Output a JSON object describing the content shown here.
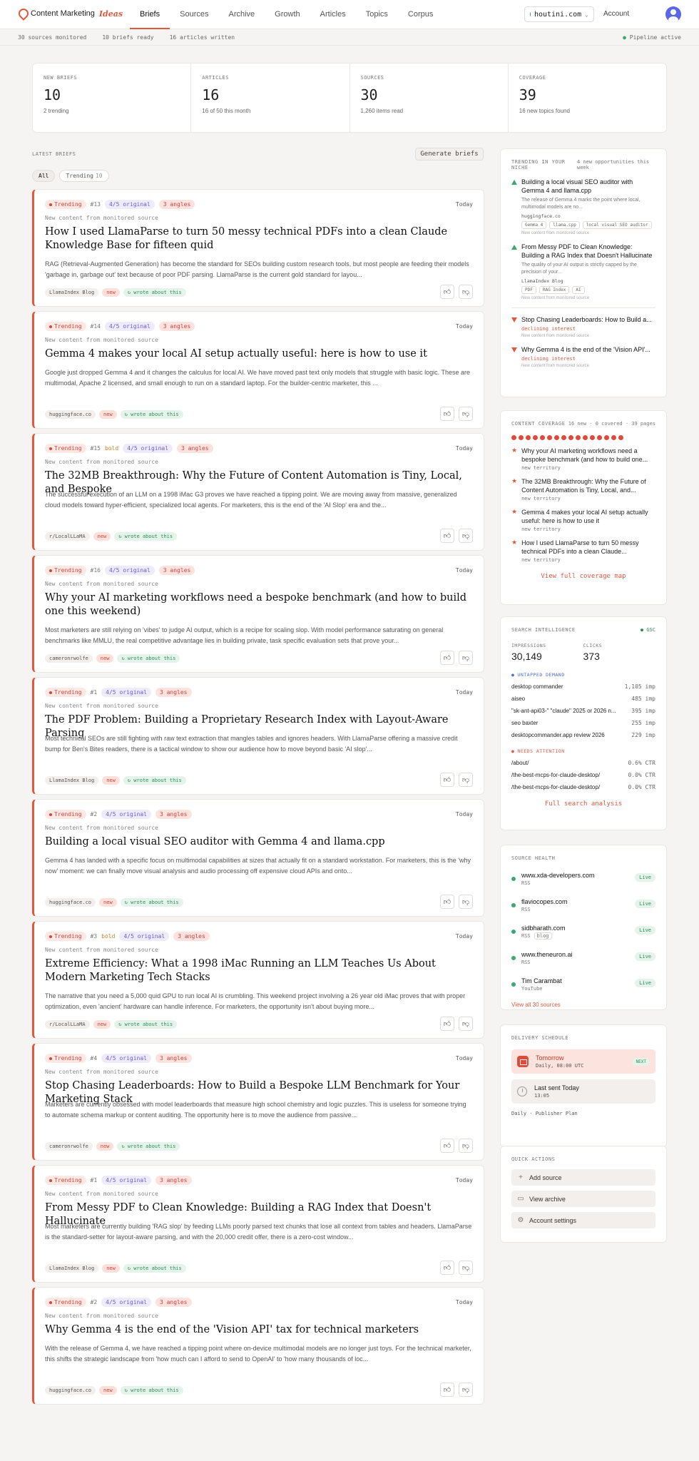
{
  "header": {
    "brand": "Content Marketing",
    "brand_accent": "Ideas",
    "nav": [
      "Briefs",
      "Sources",
      "Archive",
      "Growth",
      "Articles",
      "Topics",
      "Corpus"
    ],
    "active_nav": "Briefs",
    "domain": "houtini.com",
    "account": "Account"
  },
  "statusbar": {
    "items": [
      "30 sources monitored",
      "10 briefs ready",
      "16 articles written"
    ],
    "pipeline": "Pipeline active"
  },
  "stats": [
    {
      "label": "NEW BRIEFS",
      "value": "10",
      "sub": "2 trending"
    },
    {
      "label": "ARTICLES",
      "value": "16",
      "sub": "16 of 50 this month"
    },
    {
      "label": "SOURCES",
      "value": "30",
      "sub": "1,260 items read"
    },
    {
      "label": "COVERAGE",
      "value": "39",
      "sub": "16 new topics found"
    }
  ],
  "latest": {
    "label": "LATEST BRIEFS",
    "generate": "Generate briefs",
    "filter_all": "All",
    "filter_trending": "Trending",
    "filter_trending_count": "10"
  },
  "briefs": [
    {
      "rank": "#13",
      "bold": "",
      "original": "4/5 original",
      "angles": "3 angles",
      "date": "Today",
      "note": "New content from monitored source",
      "title": "How I used LlamaParse to turn 50 messy technical PDFs into a clean Claude Knowledge Base for fifteen quid",
      "two": true,
      "body": "RAG (Retrieval-Augmented Generation) has become the standard for SEOs building custom research tools, but most people are feeding their models 'garbage in, garbage out' text because of poor PDF parsing. LlamaParse is the current gold standard for layou...",
      "source": "LlamaIndex Blog",
      "new": "new",
      "wrote": "↻ wrote about this"
    },
    {
      "rank": "#14",
      "bold": "",
      "original": "4/5 original",
      "angles": "3 angles",
      "date": "Today",
      "note": "New content from monitored source",
      "title": "Gemma 4 makes your local AI setup actually useful: here is how to use it",
      "two": false,
      "body": "Google just dropped Gemma 4 and it changes the calculus for local AI. We have moved past text only models that struggle with basic logic. These are multimodal, Apache 2 licensed, and small enough to run on a standard laptop. For the builder-centric marketer, this ...",
      "source": "huggingface.co",
      "new": "new",
      "wrote": "↻ wrote about this"
    },
    {
      "rank": "#15",
      "bold": "bold",
      "original": "4/5 original",
      "angles": "3 angles",
      "date": "Today",
      "note": "New content from monitored source",
      "title": "The 32MB Breakthrough: Why the Future of Content Automation is Tiny, Local, and Bespoke",
      "two": false,
      "body": "The successful execution of an LLM on a 1998 iMac G3 proves we have reached a tipping point. We are moving away from massive, generalized cloud models toward hyper-efficient, specialized local agents. For marketers, this is the end of the 'AI Slop' era and the...",
      "source": "r/LocalLLaMA",
      "new": "new",
      "wrote": "↻ wrote about this"
    },
    {
      "rank": "#16",
      "bold": "",
      "original": "4/5 original",
      "angles": "3 angles",
      "date": "Today",
      "note": "New content from monitored source",
      "title": "Why your AI marketing workflows need a bespoke benchmark (and how to build one this weekend)",
      "two": true,
      "body": "Most marketers are still relying on 'vibes' to judge AI output, which is a recipe for scaling slop. With model performance saturating on general benchmarks like MMLU, the real competitive advantage lies in building private, task specific evaluation sets that prove your...",
      "source": "cameronrwolfe",
      "new": "new",
      "wrote": "↻ wrote about this"
    },
    {
      "rank": "#1",
      "bold": "",
      "original": "4/5 original",
      "angles": "3 angles",
      "date": "Today",
      "note": "New content from monitored source",
      "title": "The PDF Problem: Building a Proprietary Research Index with Layout-Aware Parsing",
      "two": false,
      "body": "Most technical SEOs are still fighting with raw text extraction that mangles tables and ignores headers. With LlamaParse offering a massive credit bump for Ben's Bites readers, there is a tactical window to show our audience how to move beyond basic 'AI slop'...",
      "source": "LlamaIndex Blog",
      "new": "new",
      "wrote": "↻ wrote about this"
    },
    {
      "rank": "#2",
      "bold": "",
      "original": "4/5 original",
      "angles": "3 angles",
      "date": "Today",
      "note": "New content from monitored source",
      "title": "Building a local visual SEO auditor with Gemma 4 and llama.cpp",
      "two": false,
      "body": "Gemma 4 has landed with a specific focus on multimodal capabilities at sizes that actually fit on a standard workstation. For marketers, this is the 'why now' moment: we can finally move visual analysis and audio processing off expensive cloud APIs and onto...",
      "source": "huggingface.co",
      "new": "new",
      "wrote": "↻ wrote about this"
    },
    {
      "rank": "#3",
      "bold": "bold",
      "original": "4/5 original",
      "angles": "3 angles",
      "date": "Today",
      "note": "New content from monitored source",
      "title": "Extreme Efficiency: What a 1998 iMac Running an LLM Teaches Us About Modern Marketing Tech Stacks",
      "two": true,
      "body": "The narrative that you need a 5,000 quid GPU to run local AI is crumbling. This weekend project involving a 26 year old iMac proves that with proper optimization, even 'ancient' hardware can handle inference. For marketers, the opportunity isn't about buying more...",
      "source": "r/LocalLLaMA",
      "new": "new",
      "wrote": "↻ wrote about this"
    },
    {
      "rank": "#4",
      "bold": "",
      "original": "4/5 original",
      "angles": "3 angles",
      "date": "Today",
      "note": "New content from monitored source",
      "title": "Stop Chasing Leaderboards: How to Build a Bespoke LLM Benchmark for Your Marketing Stack",
      "two": false,
      "body": "Marketers are currently obsessed with model leaderboards that measure high school chemistry and logic puzzles. This is useless for someone trying to automate schema markup or content auditing. The opportunity here is to move the audience from passive...",
      "source": "cameronrwolfe",
      "new": "new",
      "wrote": "↻ wrote about this"
    },
    {
      "rank": "#1",
      "bold": "",
      "original": "4/5 original",
      "angles": "3 angles",
      "date": "Today",
      "note": "New content from monitored source",
      "title": "From Messy PDF to Clean Knowledge: Building a RAG Index that Doesn't Hallucinate",
      "two": false,
      "body": "Most marketers are currently building 'RAG slop' by feeding LLMs poorly parsed text chunks that lose all context from tables and headers. LlamaParse is the standard-setter for layout-aware parsing, and with the 20,000 credit offer, there is a zero-cost window...",
      "source": "LlamaIndex Blog",
      "new": "new",
      "wrote": "↻ wrote about this"
    },
    {
      "rank": "#2",
      "bold": "",
      "original": "4/5 original",
      "angles": "3 angles",
      "date": "Today",
      "note": "New content from monitored source",
      "title": "Why Gemma 4 is the end of the 'Vision API' tax for technical marketers",
      "two": false,
      "body": "With the release of Gemma 4, we have reached a tipping point where on-device multimodal models are no longer just toys. For the technical marketer, this shifts the strategic landscape from 'how much can I afford to send to OpenAI' to 'how many thousands of loc...",
      "source": "huggingface.co",
      "new": "new",
      "wrote": "↻ wrote about this"
    }
  ],
  "trending": {
    "title": "TRENDING IN YOUR NICHE",
    "meta": "4 new opportunities this week",
    "items": [
      {
        "dir": "up",
        "title": "Building a local visual SEO auditor with Gemma 4 and llama.cpp",
        "desc": "The release of Gemma 4 marks the point where local, multimodal models are no...",
        "source": "huggingface.co",
        "tags": [
          "Gemma 4",
          "llama.cpp",
          "local visual SEO auditor"
        ],
        "note": "New content from monitored source"
      },
      {
        "dir": "up",
        "title": "From Messy PDF to Clean Knowledge: Building a RAG Index that Doesn't Hallucinate",
        "desc": "The quality of your AI output is strictly capped by the precision of your...",
        "source": "LlamaIndex Blog",
        "tags": [
          "PDF",
          "RAG Index",
          "AI"
        ],
        "note": "New content from monitored source"
      },
      {
        "dir": "down",
        "title": "Stop Chasing Leaderboards: How to Build a...",
        "status": "declining interest",
        "note": "New content from monitored source"
      },
      {
        "dir": "down",
        "title": "Why Gemma 4 is the end of the 'Vision API'...",
        "status": "declining interest",
        "note": "New content from monitored source"
      }
    ]
  },
  "coverage": {
    "title": "CONTENT COVERAGE",
    "meta": "16 new · 0 covered · 39 pages",
    "dots": 16,
    "items": [
      {
        "title": "Why your AI marketing workflows need a bespoke benchmark (and how to build one...",
        "tag": "new territory"
      },
      {
        "title": "The 32MB Breakthrough: Why the Future of Content Automation is Tiny, Local, and...",
        "tag": "new territory"
      },
      {
        "title": "Gemma 4 makes your local AI setup actually useful: here is how to use it",
        "tag": "new territory"
      },
      {
        "title": "How I used LlamaParse to turn 50 messy technical PDFs into a clean Claude...",
        "tag": "new territory"
      }
    ],
    "link": "View full coverage map"
  },
  "search": {
    "title": "SEARCH INTELLIGENCE",
    "badge": "GSC",
    "impressions_label": "IMPRESSIONS",
    "impressions": "30,149",
    "clicks_label": "CLICKS",
    "clicks": "373",
    "untapped_label": "UNTAPPED DEMAND",
    "untapped": [
      {
        "k": "desktop commander",
        "v": "1,105 imp"
      },
      {
        "k": "aiseo",
        "v": "485 imp"
      },
      {
        "k": "\"sk-ant-api03-\" \"claude\" 2025 or 2026 n...",
        "v": "395 imp"
      },
      {
        "k": "seo baxter",
        "v": "255 imp"
      },
      {
        "k": "desktopcommander.app review 2026",
        "v": "229 imp"
      }
    ],
    "attention_label": "NEEDS ATTENTION",
    "attention": [
      {
        "k": "/about/",
        "v": "0.6% CTR"
      },
      {
        "k": "/the-best-mcps-for-claude-desktop/",
        "v": "0.0% CTR"
      },
      {
        "k": "/the-best-mcps-for-claude-desktop/",
        "v": "0.0% CTR"
      }
    ],
    "link": "Full search analysis"
  },
  "health": {
    "title": "SOURCE HEALTH",
    "sources": [
      {
        "name": "www.xda-developers.com",
        "type": "RSS",
        "extra": "",
        "status": "Live"
      },
      {
        "name": "flaviocopes.com",
        "type": "RSS",
        "extra": "",
        "status": "Live"
      },
      {
        "name": "sidbharath.com",
        "type": "RSS",
        "extra": "blog",
        "status": "Live"
      },
      {
        "name": "www.theneuron.ai",
        "type": "RSS",
        "extra": "",
        "status": "Live"
      },
      {
        "name": "Tim Carambat",
        "type": "YouTube",
        "extra": "",
        "status": "Live"
      }
    ],
    "link": "View all 30 sources"
  },
  "delivery": {
    "title": "DELIVERY SCHEDULE",
    "next_title": "Tomorrow",
    "next_sub": "Daily, 08:00 UTC",
    "next_badge": "NEXT",
    "last_title": "Last sent Today",
    "last_sub": "13:05",
    "plan": "Daily · Publisher Plan"
  },
  "quick": {
    "title": "QUICK ACTIONS",
    "add": "Add source",
    "archive": "View archive",
    "settings": "Account settings"
  },
  "colors": {
    "accent": "#e0593f",
    "live": "#3aa96a",
    "orig": "#6b5bd6"
  }
}
